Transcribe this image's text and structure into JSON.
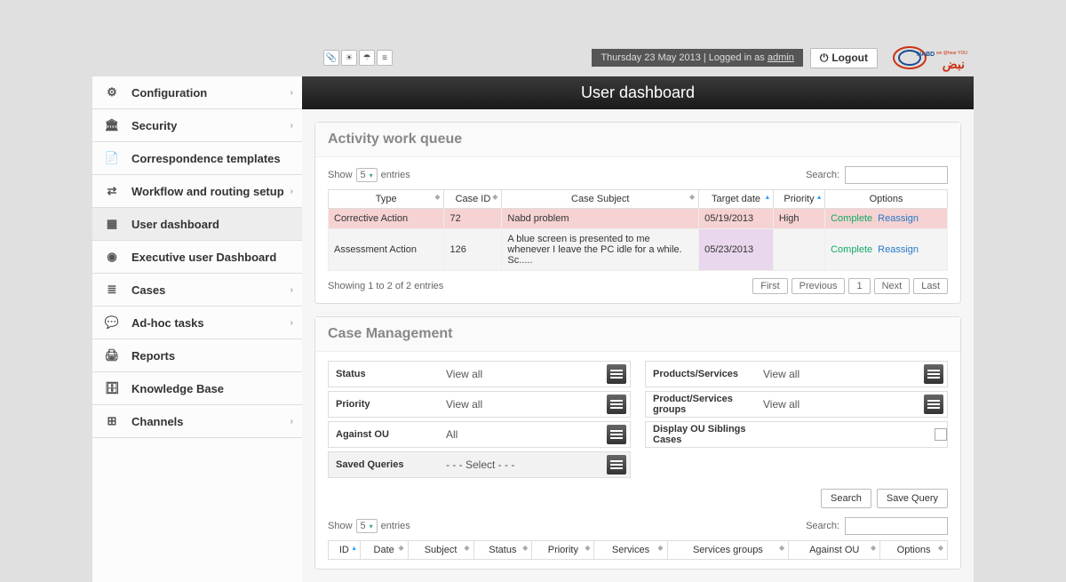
{
  "header": {
    "status_text": "Thursday 23 May 2013 | Logged in as ",
    "status_user": "admin",
    "logout": "Logout",
    "page_title": "User dashboard"
  },
  "sidebar": {
    "items": [
      {
        "label": "Configuration",
        "expandable": true
      },
      {
        "label": "Security",
        "expandable": true
      },
      {
        "label": "Correspondence templates",
        "expandable": false
      },
      {
        "label": "Workflow and routing setup",
        "expandable": true
      },
      {
        "label": "User dashboard",
        "expandable": false,
        "active": true
      },
      {
        "label": "Executive user Dashboard",
        "expandable": false
      },
      {
        "label": "Cases",
        "expandable": true
      },
      {
        "label": "Ad-hoc tasks",
        "expandable": true
      },
      {
        "label": "Reports",
        "expandable": false
      },
      {
        "label": "Knowledge Base",
        "expandable": false
      },
      {
        "label": "Channels",
        "expandable": true
      }
    ]
  },
  "queue": {
    "title": "Activity work queue",
    "show_label": "Show",
    "show_val": "5",
    "entries_label": "entries",
    "search_label": "Search:",
    "headers": {
      "type": "Type",
      "case_id": "Case ID",
      "case_subject": "Case Subject",
      "target_date": "Target date",
      "priority": "Priority",
      "options": "Options"
    },
    "rows": [
      {
        "type": "Corrective Action",
        "case_id": "72",
        "subject": "Nabd problem",
        "target": "05/19/2013",
        "priority": "High",
        "opt1": "Complete",
        "opt2": "Reassign"
      },
      {
        "type": "Assessment Action",
        "case_id": "126",
        "subject": "A blue screen is presented to me whenever I leave the PC idle for a while. Sc.....",
        "target": "05/23/2013",
        "priority": "",
        "opt1": "Complete",
        "opt2": "Reassign"
      }
    ],
    "info": "Showing 1 to 2 of 2 entries",
    "pager": {
      "first": "First",
      "prev": "Previous",
      "page": "1",
      "next": "Next",
      "last": "Last"
    }
  },
  "mgmt": {
    "title": "Case Management",
    "left": [
      {
        "label": "Status",
        "val": "View all"
      },
      {
        "label": "Priority",
        "val": "View all"
      },
      {
        "label": "Against OU",
        "val": "All"
      },
      {
        "label": "Saved Queries",
        "val": "- - - Select - - -",
        "saved": true
      }
    ],
    "right": [
      {
        "label": "Products/Services",
        "val": "View all",
        "icon": true
      },
      {
        "label": "Product/Services groups",
        "val": "View all",
        "icon": true
      },
      {
        "label": "Display OU Siblings Cases",
        "chk": true
      }
    ],
    "search_btn": "Search",
    "save_query_btn": "Save Query",
    "show_label": "Show",
    "show_val": "5",
    "entries_label": "entries",
    "search_label": "Search:",
    "headers": {
      "id": "ID",
      "date": "Date",
      "subject": "Subject",
      "status": "Status",
      "priority": "Priority",
      "services": "Services",
      "sg": "Services groups",
      "against": "Against OU",
      "options": "Options"
    }
  }
}
